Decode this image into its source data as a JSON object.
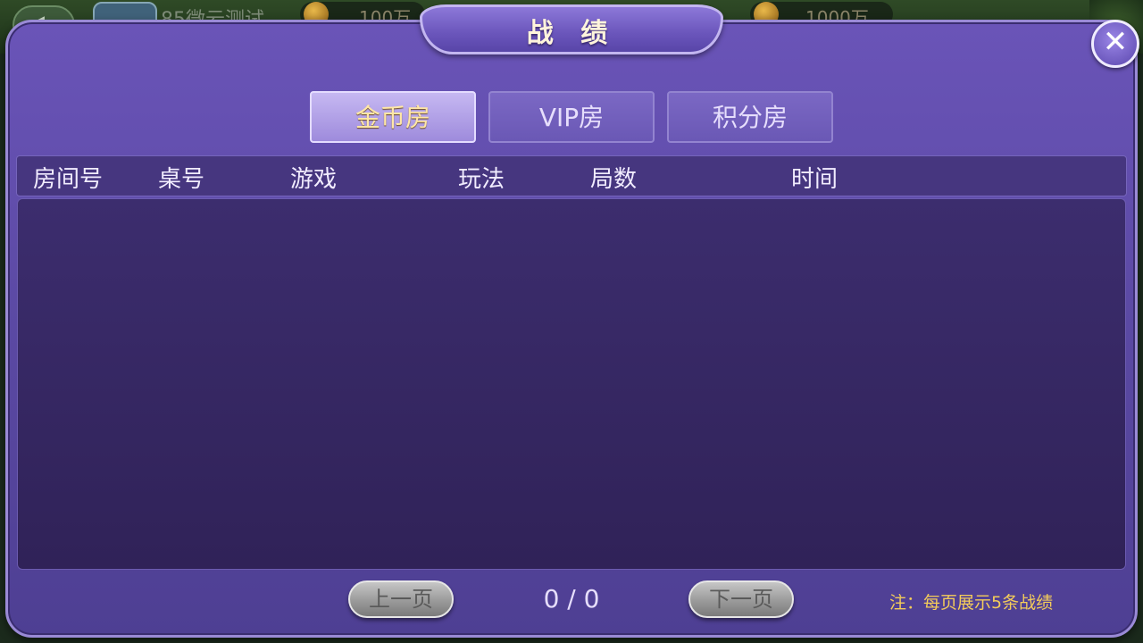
{
  "background": {
    "back_icon": "back-arrow-icon",
    "player_name": "85微云测试",
    "coin_amount": "100万",
    "second_amount": "1000万"
  },
  "dialog": {
    "title": "战 绩",
    "close_icon": "close-icon",
    "close_glyph": "✕"
  },
  "tabs": [
    {
      "label": "金币房",
      "active": true
    },
    {
      "label": "VIP房",
      "active": false
    },
    {
      "label": "积分房",
      "active": false
    }
  ],
  "table": {
    "columns": [
      "房间号",
      "桌号",
      "游戏",
      "玩法",
      "局数",
      "时间"
    ],
    "rows": []
  },
  "pagination": {
    "prev_label": "上一页",
    "next_label": "下一页",
    "indicator": "0 / 0"
  },
  "note": "注：每页展示5条战绩",
  "colors": {
    "dialog_purple": "#5c4aa5",
    "active_tab_text": "#ffe7a6",
    "note_gold": "#f4cc5a"
  }
}
